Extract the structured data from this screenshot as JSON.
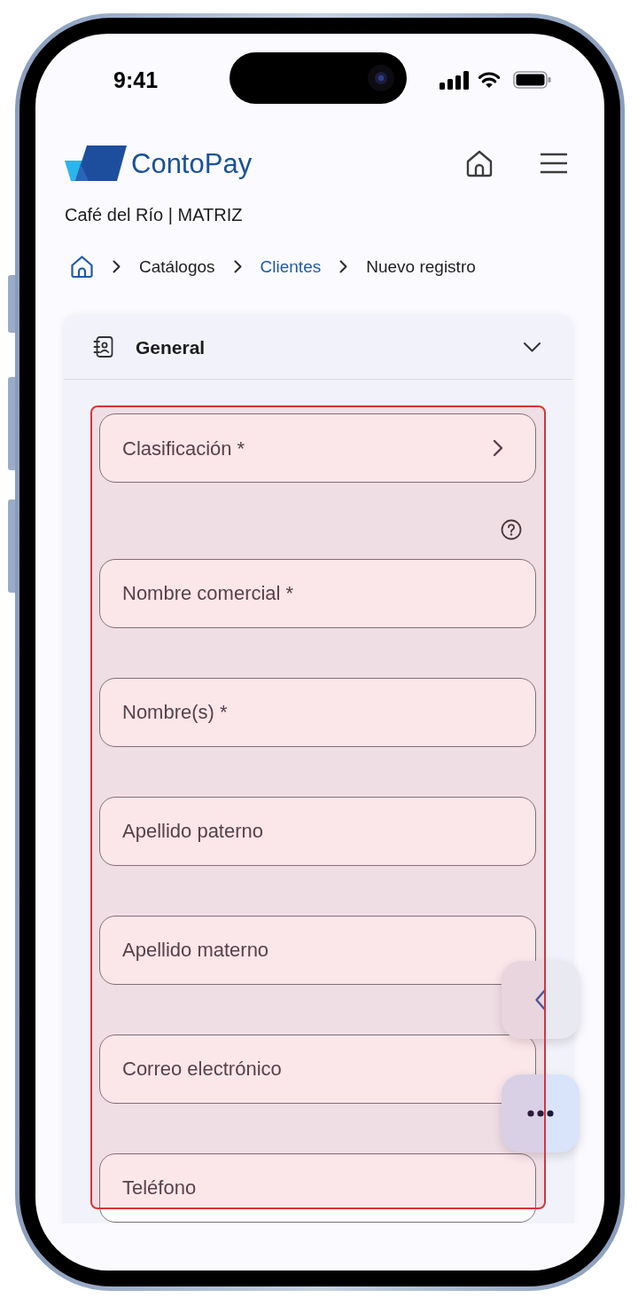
{
  "status_bar": {
    "time": "9:41"
  },
  "header": {
    "logo_text": "ContoPay",
    "business": "Café del Río | MATRIZ"
  },
  "breadcrumb": [
    {
      "label": "Catálogos",
      "link": false
    },
    {
      "label": "Clientes",
      "link": true
    },
    {
      "label": "Nuevo registro",
      "link": false
    }
  ],
  "section": {
    "title": "General",
    "expanded": true,
    "highlighted": true,
    "fields": [
      {
        "kind": "select",
        "label": "Clasificación *",
        "help": false
      },
      {
        "kind": "text",
        "placeholder": "Nombre comercial *",
        "help": true
      },
      {
        "kind": "text",
        "placeholder": "Nombre(s) *",
        "help": false
      },
      {
        "kind": "text",
        "placeholder": "Apellido paterno",
        "help": false
      },
      {
        "kind": "text",
        "placeholder": "Apellido materno",
        "help": false
      },
      {
        "kind": "text",
        "placeholder": "Correo electrónico",
        "help": false
      },
      {
        "kind": "text",
        "placeholder": "Teléfono",
        "help": false
      }
    ]
  },
  "floating_buttons": [
    {
      "kind": "back"
    },
    {
      "kind": "more"
    }
  ]
}
